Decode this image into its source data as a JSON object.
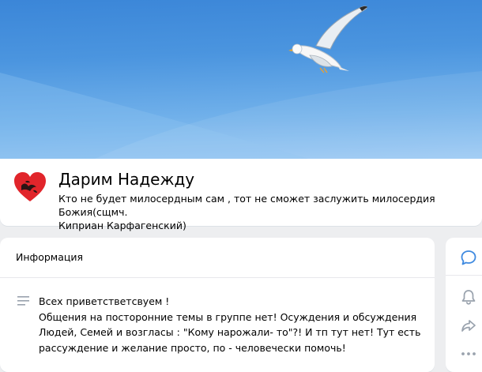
{
  "group": {
    "title": "Дарим Надежду",
    "status_line1": "Кто не будет милосердным сам , тот не сможет заслужить милосердия Божия(сщмч.",
    "status_line2": "Киприан Карфагенский)"
  },
  "info": {
    "heading": "Информация",
    "lines": [
      "Всех приветстветсвуем !",
      "Общения на посторонние темы в группе нет! Осуждения и обсуждения",
      "Людей, Семей и возгласы : \"Кому нарожали- то\"?! И тп тут нет! Тут есть",
      "рассуждение и желание просто, по - человечески помочь!"
    ]
  },
  "icons": {
    "avatar": "heart-logo-icon",
    "info": "text-lines-icon",
    "side": [
      "message-bubble-icon",
      "bell-icon",
      "share-arrow-icon",
      "more-dots-icon"
    ]
  },
  "colors": {
    "accent": "#2a5885",
    "icon_blue": "#3f8ae0",
    "icon_gray": "#99a2ad",
    "heart": "#e1252b"
  }
}
